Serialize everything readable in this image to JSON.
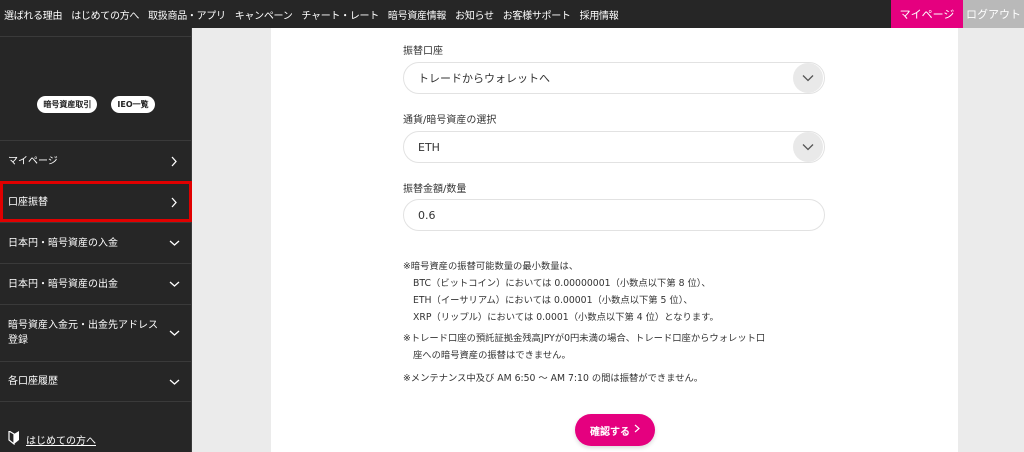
{
  "topnav": {
    "links": [
      "選ばれる理由",
      "はじめての方へ",
      "取扱商品・アプリ",
      "キャンペーン",
      "チャート・レート",
      "暗号資産情報",
      "お知らせ",
      "お客様サポート",
      "採用情報"
    ],
    "mypage_label": "マイページ",
    "logout_label": "ログアウト"
  },
  "sidebar": {
    "tags": [
      "暗号資産取引",
      "IEO一覧"
    ],
    "items": [
      {
        "label": "マイページ",
        "icon": "chevron-right-icon"
      },
      {
        "label": "口座振替",
        "icon": "chevron-right-icon",
        "active": true
      },
      {
        "label": "日本円・暗号資産の入金",
        "icon": "chevron-down-icon"
      },
      {
        "label": "日本円・暗号資産の出金",
        "icon": "chevron-down-icon"
      },
      {
        "label": "暗号資産入金元・出金先アドレス登録",
        "icon": "chevron-down-icon"
      },
      {
        "label": "各口座履歴",
        "icon": "chevron-down-icon"
      }
    ],
    "helper_label": "はじめての方へ",
    "helper_icon": "beginner-mark-icon"
  },
  "form": {
    "transfer_label": "振替口座",
    "transfer_value": "トレードからウォレットへ",
    "currency_label": "通貨/暗号資産の選択",
    "currency_value": "ETH",
    "amount_label": "振替金額/数量",
    "amount_value": "0.6"
  },
  "notes": {
    "line1": "※暗号資産の振替可能数量の最小数量は、",
    "line2": "BTC（ビットコイン）においては 0.00000001（小数点以下第 8 位）、",
    "line3": "ETH（イーサリアム）においては 0.00001（小数点以下第 5 位）、",
    "line4": "XRP（リップル）においては 0.0001（小数点以下第 4 位）となります。",
    "line5": "※トレード口座の預託証拠金残高JPYが0円未満の場合、トレード口座からウォレット口",
    "line6": "座への暗号資産の振替はできません。",
    "line7": "※メンテナンス中及び AM 6:50 ～ AM 7:10 の間は振替ができません。"
  },
  "confirm_label": "確認する",
  "colors": {
    "accent": "#e5007f",
    "nav_bg": "#262626",
    "highlight": "#e00000"
  }
}
